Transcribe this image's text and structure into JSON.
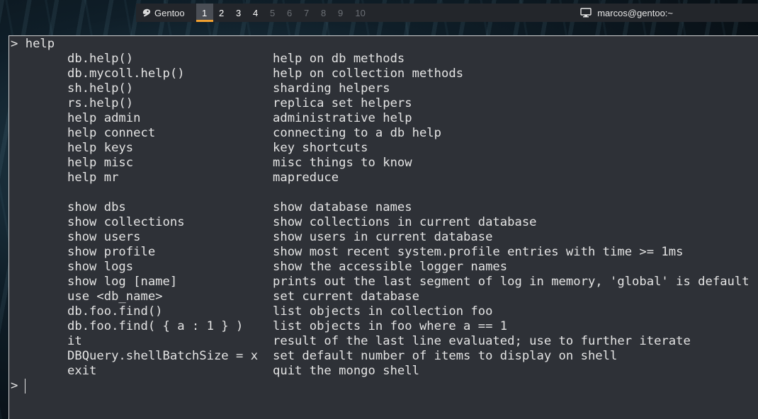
{
  "topbar": {
    "distro": "Gentoo",
    "workspaces": [
      "1",
      "2",
      "3",
      "4",
      "5",
      "6",
      "7",
      "8",
      "9",
      "10"
    ],
    "active_workspace": "1",
    "user_host": "marcos@gentoo:~",
    "accent_color": "#f0a030"
  },
  "terminal": {
    "prompt": ">",
    "first_command": "help",
    "help_rows": [
      {
        "cmd": "db.help()",
        "desc": "help on db methods"
      },
      {
        "cmd": "db.mycoll.help()",
        "desc": "help on collection methods"
      },
      {
        "cmd": "sh.help()",
        "desc": "sharding helpers"
      },
      {
        "cmd": "rs.help()",
        "desc": "replica set helpers"
      },
      {
        "cmd": "help admin",
        "desc": "administrative help"
      },
      {
        "cmd": "help connect",
        "desc": "connecting to a db help"
      },
      {
        "cmd": "help keys",
        "desc": "key shortcuts"
      },
      {
        "cmd": "help misc",
        "desc": "misc things to know"
      },
      {
        "cmd": "help mr",
        "desc": "mapreduce"
      },
      {
        "cmd": "show dbs",
        "desc": "show database names"
      },
      {
        "cmd": "show collections",
        "desc": "show collections in current database"
      },
      {
        "cmd": "show users",
        "desc": "show users in current database"
      },
      {
        "cmd": "show profile",
        "desc": "show most recent system.profile entries with time >= 1ms"
      },
      {
        "cmd": "show logs",
        "desc": "show the accessible logger names"
      },
      {
        "cmd": "show log [name]",
        "desc": "prints out the last segment of log in memory, 'global' is default"
      },
      {
        "cmd": "use <db_name>",
        "desc": "set current database"
      },
      {
        "cmd": "db.foo.find()",
        "desc": "list objects in collection foo"
      },
      {
        "cmd": "db.foo.find( { a : 1 } )",
        "desc": "list objects in foo where a == 1"
      },
      {
        "cmd": "it",
        "desc": "result of the last line evaluated; use to further iterate"
      },
      {
        "cmd": "DBQuery.shellBatchSize = x",
        "desc": "set default number of items to display on shell"
      },
      {
        "cmd": "exit",
        "desc": "quit the mongo shell"
      }
    ]
  }
}
